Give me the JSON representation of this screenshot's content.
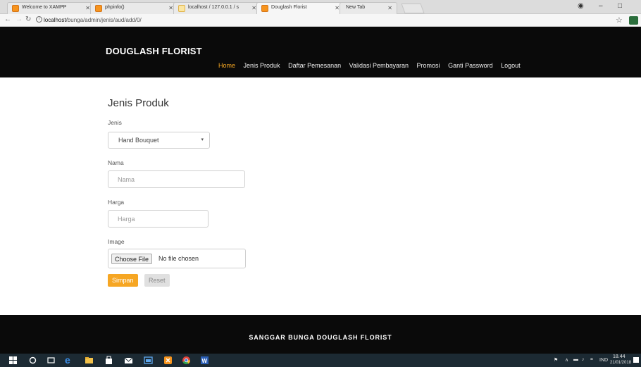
{
  "browser": {
    "tabs": [
      {
        "title": "Welcome to XAMPP",
        "active": false
      },
      {
        "title": "phpinfo()",
        "active": false
      },
      {
        "title": "localhost / 127.0.0.1 / s",
        "active": false
      },
      {
        "title": "Douglash Florist",
        "active": true
      },
      {
        "title": "New Tab",
        "active": false
      }
    ],
    "url_host": "localhost",
    "url_path": "/bunga/admin/jenis/aud/add/0/"
  },
  "header": {
    "brand": "DOUGLASH FLORIST",
    "nav": [
      "Home",
      "Jenis Produk",
      "Daftar Pemesanan",
      "Validasi Pembayaran",
      "Promosi",
      "Ganti Password",
      "Logout"
    ],
    "active_nav": "Home"
  },
  "form": {
    "title": "Jenis Produk",
    "jenis_label": "Jenis",
    "jenis_value": "Hand Bouquet",
    "nama_label": "Nama",
    "nama_placeholder": "Nama",
    "harga_label": "Harga",
    "harga_placeholder": "Harga",
    "image_label": "Image",
    "file_button": "Choose File",
    "file_status": "No file chosen",
    "save_label": "Simpan",
    "reset_label": "Reset"
  },
  "footer": {
    "text": "SANGGAR BUNGA DOUGLASH FLORIST"
  },
  "taskbar": {
    "lang": "IND",
    "time": "18.44",
    "date": "21/01/2018"
  },
  "colors": {
    "accent": "#f6a623",
    "header_bg": "#0a0a0a",
    "taskbar_bg": "#1c2a33"
  }
}
